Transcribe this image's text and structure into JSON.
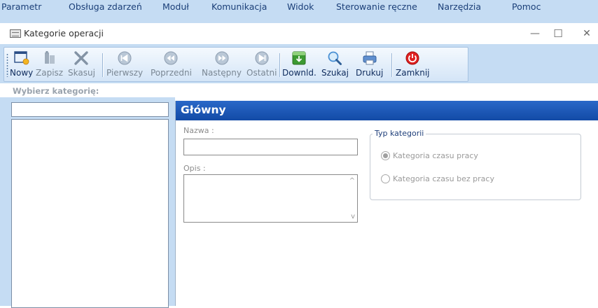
{
  "menu": [
    "Parametr",
    "Obsługa zdarzeń",
    "Moduł",
    "Komunikacja",
    "Widok",
    "Sterowanie ręczne",
    "Narzędzia",
    "Pomoc"
  ],
  "window": {
    "title": "Kategorie operacji",
    "minimize": "—",
    "maximize": "☐",
    "close": "✕"
  },
  "toolbar": [
    {
      "label": "Nowy",
      "icon": "new-document-icon",
      "enabled": true
    },
    {
      "label": "Zapisz",
      "icon": "save-icon",
      "enabled": false
    },
    {
      "label": "Skasuj",
      "icon": "delete-x-icon",
      "enabled": false
    },
    {
      "label": "Pierwszy",
      "icon": "first-record-icon",
      "enabled": false
    },
    {
      "label": "Poprzedni",
      "icon": "previous-record-icon",
      "enabled": false
    },
    {
      "label": "Następny",
      "icon": "next-record-icon",
      "enabled": false
    },
    {
      "label": "Ostatni",
      "icon": "last-record-icon",
      "enabled": false
    },
    {
      "label": "Downld.",
      "icon": "download-icon",
      "enabled": true
    },
    {
      "label": "Szukaj",
      "icon": "search-icon",
      "enabled": true
    },
    {
      "label": "Drukuj",
      "icon": "printer-icon",
      "enabled": true
    },
    {
      "label": "Zamknij",
      "icon": "power-icon",
      "enabled": true
    }
  ],
  "left": {
    "label": "Wybierz kategorię:",
    "search_value": ""
  },
  "main": {
    "header": "Główny",
    "name_label": "Nazwa :",
    "name_value": "",
    "desc_label": "Opis :",
    "desc_value": "",
    "scroll_up": "^",
    "scroll_down": "v",
    "group_title": "Typ kategorii",
    "radio_options": [
      {
        "label": "Kategoria czasu pracy",
        "selected": true
      },
      {
        "label": "Kategoria czasu bez pracy",
        "selected": false
      }
    ]
  },
  "colors": {
    "menubar_bg": "#c5dcf3",
    "header_blue": "#1a56b8",
    "exit_red": "#e02020",
    "download_green": "#3c9a32"
  }
}
